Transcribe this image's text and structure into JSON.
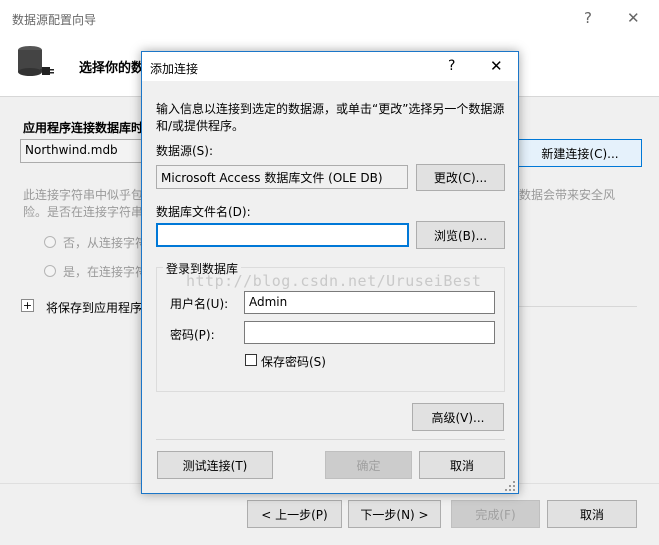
{
  "wizard": {
    "title": "数据源配置向导",
    "header_text": "选择你的数",
    "section_label": "应用程序连接数据库时",
    "connection_value": "Northwind.mdb",
    "new_connection_button": "新建连接(C)...",
    "warning_left_line1": "此连接字符串中似乎包",
    "warning_left_line2": "险。是否在连接字符串",
    "warning_right": "数据会带来安全风",
    "radio_no": "否，从连接字符",
    "radio_yes": "是，在连接字符",
    "expand_label": "将保存到应用程序",
    "expand_glyph": "+",
    "help_glyph": "?",
    "close_glyph": "✕",
    "buttons": {
      "prev": "< 上一步(P)",
      "next": "下一步(N) >",
      "finish": "完成(F)",
      "cancel": "取消"
    }
  },
  "dialog": {
    "title": "添加连接",
    "help_glyph": "?",
    "close_glyph": "✕",
    "instruction_line1": "输入信息以连接到选定的数据源，或单击“更改”选择另一个数据源",
    "instruction_line2": "和/或提供程序。",
    "datasource_label": "数据源(S):",
    "datasource_value": "Microsoft Access 数据库文件 (OLE DB)",
    "change_button": "更改(C)...",
    "dbfile_label": "数据库文件名(D):",
    "dbfile_value": "",
    "browse_button": "浏览(B)...",
    "login_group_label": "登录到数据库",
    "username_label": "用户名(U):",
    "username_value": "Admin",
    "password_label": "密码(P):",
    "password_value": "",
    "save_password_label": "保存密码(S)",
    "advanced_button": "高级(V)...",
    "test_button": "测试连接(T)",
    "ok_button": "确定",
    "cancel_button": "取消",
    "watermark": "http://blog.csdn.net/UruseiBest"
  }
}
